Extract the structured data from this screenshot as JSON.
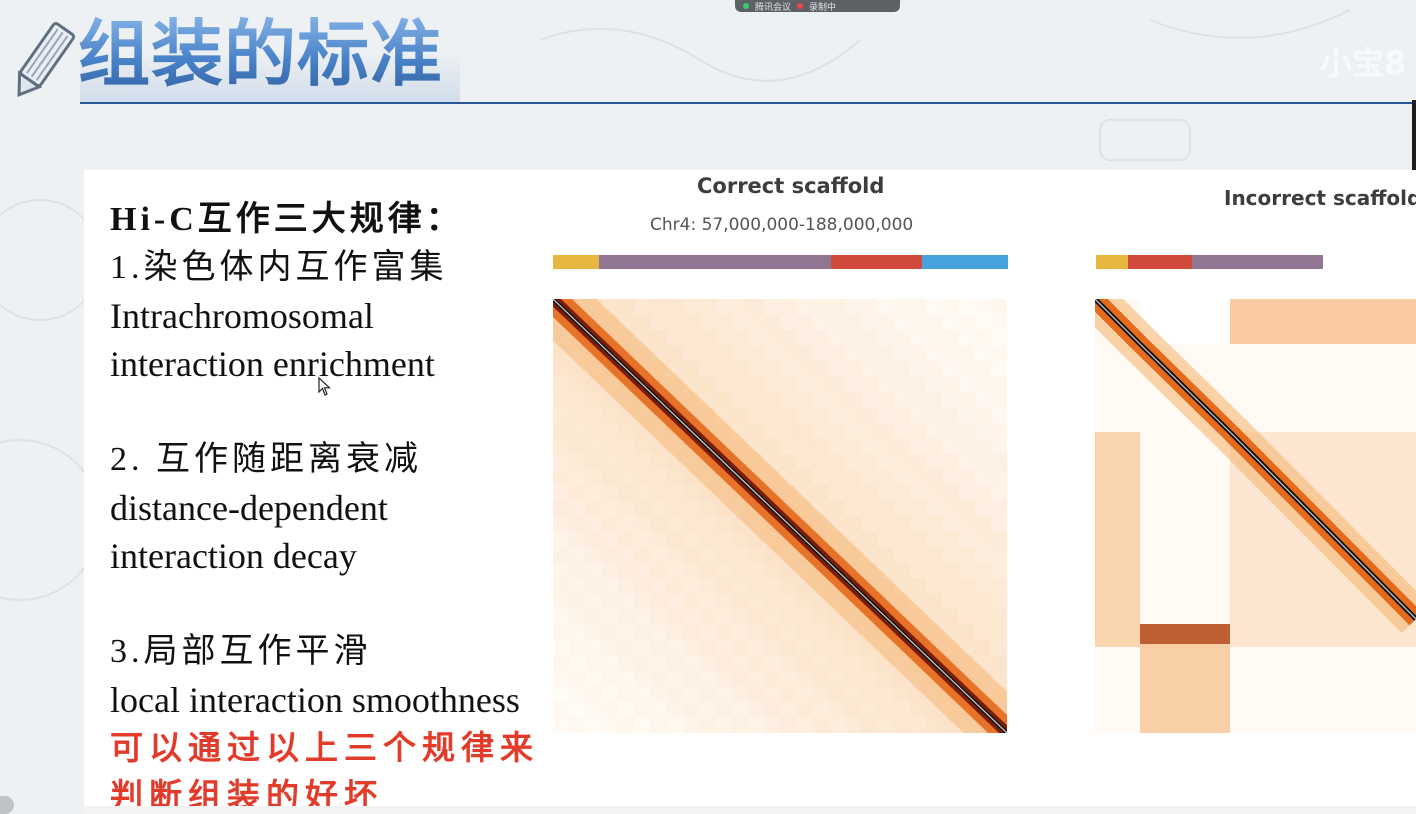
{
  "meeting_bar": {
    "app_label": "腾讯会议",
    "recording_label": "录制中"
  },
  "watermark": "小宝8",
  "slide": {
    "title": "组装的标准",
    "heading": "Hi-C互作三大规律：",
    "rule1_zh": "1.染色体内互作富集",
    "rule1_en_line1": "Intrachromosomal",
    "rule1_en_line2": "interaction enrichment",
    "rule2_zh": "2. 互作随距离衰减",
    "rule2_en_line1": "distance-dependent",
    "rule2_en_line2": "interaction decay",
    "rule3_zh": "3.局部互作平滑",
    "rule3_en": "local interaction smoothness",
    "note_line1": "可以通过以上三个规律来",
    "note_line2": "判断组装的好坏"
  },
  "panels": {
    "correct": {
      "title": "Correct scaffold",
      "subtitle": "Chr4: 57,000,000-188,000,000",
      "segments": [
        {
          "color": "#e7b841",
          "fraction": 0.1
        },
        {
          "color": "#907691",
          "fraction": 0.51
        },
        {
          "color": "#d24a3d",
          "fraction": 0.2
        },
        {
          "color": "#48a3dc",
          "fraction": 0.19
        }
      ]
    },
    "incorrect": {
      "title": "Incorrect scaffold",
      "segments": [
        {
          "color": "#e7b841",
          "fraction": 0.1
        },
        {
          "color": "#d24a3d",
          "fraction": 0.2
        },
        {
          "color": "#907691",
          "fraction": 0.41
        }
      ]
    }
  },
  "colors": {
    "title_blue": "#3f78c0",
    "rule_line": "#2a5594",
    "note_red": "#e23b2a",
    "heat_dark": "#1a0f0a",
    "heat_mid": "#e0701e",
    "heat_light": "#fff6e6"
  },
  "icons": [
    "pencil-icon",
    "mouse-cursor-icon",
    "record-dot-icon",
    "signal-icon"
  ]
}
